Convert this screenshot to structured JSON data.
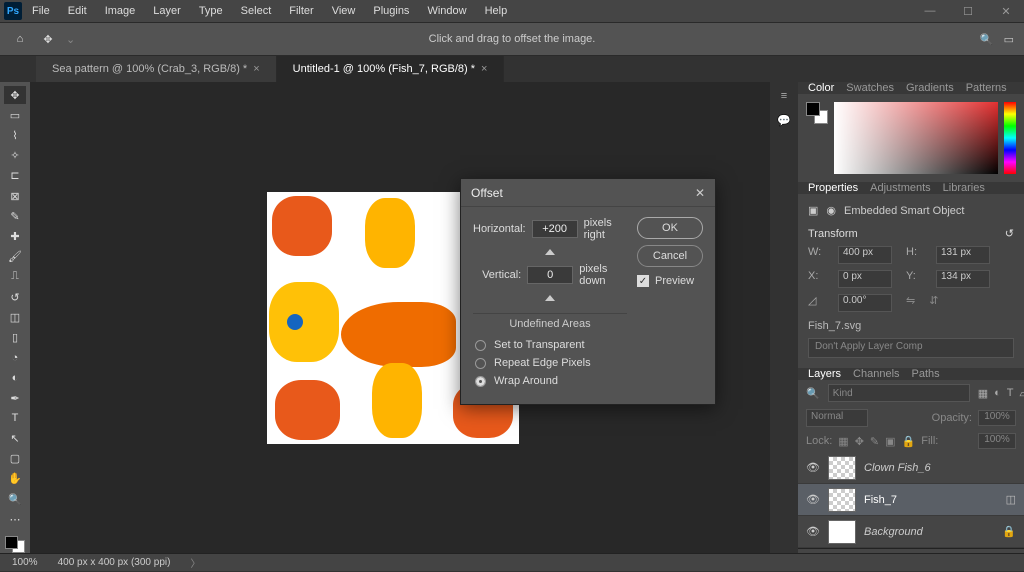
{
  "menubar": {
    "items": [
      "File",
      "Edit",
      "Image",
      "Layer",
      "Type",
      "Select",
      "Filter",
      "View",
      "Plugins",
      "Window",
      "Help"
    ]
  },
  "optionsbar": {
    "hint": "Click and drag to offset the image."
  },
  "tabs": [
    {
      "label": "Sea pattern @ 100% (Crab_3, RGB/8) *",
      "active": false
    },
    {
      "label": "Untitled-1 @ 100% (Fish_7, RGB/8) *",
      "active": true
    }
  ],
  "dialog": {
    "title": "Offset",
    "horizontal_label": "Horizontal:",
    "horizontal_value": "+200",
    "horizontal_unit": "pixels right",
    "vertical_label": "Vertical:",
    "vertical_value": "0",
    "vertical_unit": "pixels down",
    "undefined_areas_label": "Undefined Areas",
    "radio_transparent": "Set to Transparent",
    "radio_repeat": "Repeat Edge Pixels",
    "radio_wrap": "Wrap Around",
    "ok": "OK",
    "cancel": "Cancel",
    "preview_label": "Preview",
    "preview_checked": true,
    "selected_radio": "wrap"
  },
  "panel_color": {
    "tabs": [
      "Color",
      "Swatches",
      "Gradients",
      "Patterns"
    ],
    "active": 0
  },
  "panel_props": {
    "tabs": [
      "Properties",
      "Adjustments",
      "Libraries"
    ],
    "active": 0,
    "type_label": "Embedded Smart Object",
    "transform_label": "Transform",
    "w_label": "W:",
    "w_value": "400 px",
    "h_label": "H:",
    "h_value": "131 px",
    "x_label": "X:",
    "x_value": "0 px",
    "y_label": "Y:",
    "y_value": "134 px",
    "angle": "0.00°",
    "filename": "Fish_7.svg",
    "layercomp": "Don't Apply Layer Comp"
  },
  "panel_layers": {
    "tabs": [
      "Layers",
      "Channels",
      "Paths"
    ],
    "active": 0,
    "kind_label": "Kind",
    "blend_label": "Normal",
    "opacity_label": "Opacity:",
    "opacity_value": "100%",
    "lock_label": "Lock:",
    "fill_label": "Fill:",
    "fill_value": "100%",
    "layers": [
      {
        "name": "Clown Fish_6",
        "visible": true,
        "selected": false,
        "thumb": "checker"
      },
      {
        "name": "Fish_7",
        "visible": true,
        "selected": true,
        "thumb": "checker"
      },
      {
        "name": "Background",
        "visible": true,
        "selected": false,
        "thumb": "white",
        "locked": true
      }
    ]
  },
  "status": {
    "zoom": "100%",
    "docinfo": "400 px x 400 px (300 ppi)"
  }
}
